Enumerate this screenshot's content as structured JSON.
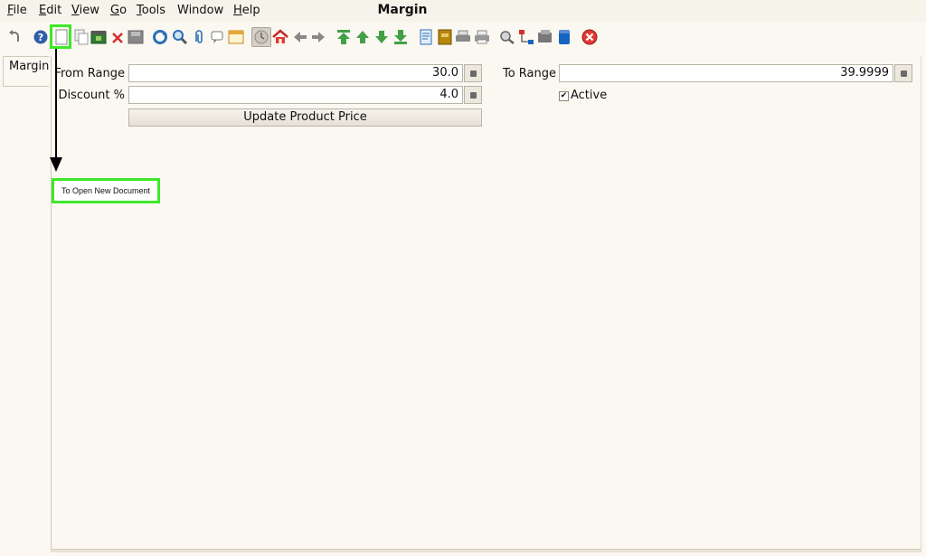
{
  "menu": {
    "file": "File",
    "edit": "Edit",
    "view": "View",
    "go": "Go",
    "tools": "Tools",
    "window": "Window",
    "help": "Help"
  },
  "window_title": "Margin",
  "left_tab": {
    "label": "Margin"
  },
  "form": {
    "from_range": {
      "label": "From Range",
      "value": "30.0"
    },
    "discount": {
      "label": "Discount %",
      "value": "4.0"
    },
    "to_range": {
      "label": "To Range",
      "value": "39.9999"
    },
    "active": {
      "label": "Active",
      "checked": true,
      "mark": "✔"
    },
    "update_button": "Update Product Price"
  },
  "annotation": {
    "callout_text": "To Open New Document",
    "color": "#3ee829"
  },
  "toolbar_icons": [
    "undo-icon",
    "help-icon",
    "new-document-icon",
    "copy-record-icon",
    "save-record-icon",
    "delete-icon",
    "save-icon",
    "refresh-icon",
    "find-icon",
    "attachment-icon",
    "chat-icon",
    "grid-toggle-icon",
    "history-icon",
    "home-icon",
    "back-icon",
    "forward-icon",
    "first-record-icon",
    "previous-record-icon",
    "next-record-icon",
    "last-record-icon",
    "report-icon",
    "archive-icon",
    "print-preview-icon",
    "print-icon",
    "zoom-across-icon",
    "workflow-icon",
    "request-icon",
    "product-info-icon",
    "close-window-icon"
  ]
}
